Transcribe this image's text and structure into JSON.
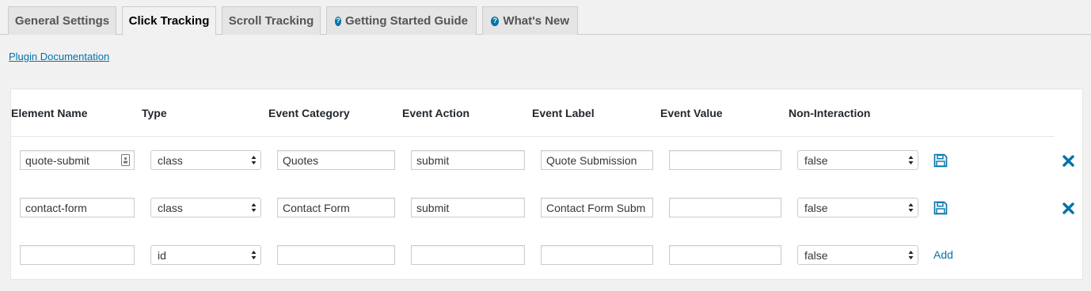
{
  "tabs": [
    {
      "label": "General Settings",
      "active": false
    },
    {
      "label": "Click Tracking",
      "active": true
    },
    {
      "label": "Scroll Tracking",
      "active": false
    },
    {
      "label": "Getting Started Guide",
      "active": false,
      "icon": "help-icon"
    },
    {
      "label": "What's New",
      "active": false,
      "icon": "help-icon"
    }
  ],
  "doc_link": "Plugin Documentation",
  "columns": [
    "Element Name",
    "Type",
    "Event Category",
    "Event Action",
    "Event Label",
    "Event Value",
    "Non-Interaction"
  ],
  "rows": [
    {
      "element_name": "quote-submit",
      "type": "class",
      "event_category": "Quotes",
      "event_action": "submit",
      "event_label": "Quote Submission",
      "event_value": "",
      "non_interaction": "false",
      "action": "save-icon",
      "delete": "delete-icon"
    },
    {
      "element_name": "contact-form",
      "type": "class",
      "event_category": "Contact Form",
      "event_action": "submit",
      "event_label": "Contact Form Subm",
      "event_value": "",
      "non_interaction": "false",
      "action": "save-icon",
      "delete": "delete-icon"
    },
    {
      "element_name": "",
      "type": "id",
      "event_category": "",
      "event_action": "",
      "event_label": "",
      "event_value": "",
      "non_interaction": "false",
      "action_label": "Add"
    }
  ],
  "colors": {
    "accent": "#0073aa",
    "background": "#f1f1f1",
    "panel": "#ffffff"
  }
}
